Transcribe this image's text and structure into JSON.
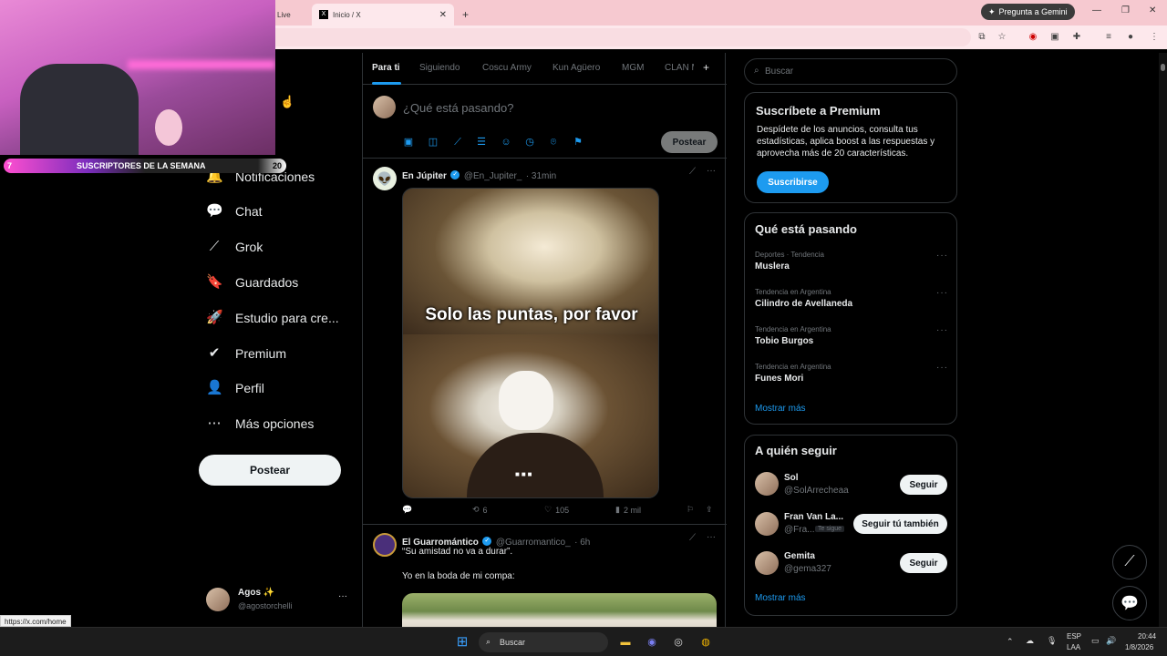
{
  "browser": {
    "tabs": [
      {
        "label": "Live"
      },
      {
        "label": "Inicio / X",
        "active": true
      }
    ],
    "new_tab": "+",
    "gemini_label": "Pregunta a Gemini",
    "status_url": "https://x.com/home"
  },
  "stream": {
    "subs_count_left": "7",
    "subs_label": "SUSCRIPTORES DE LA SEMANA",
    "subs_count_right": "20"
  },
  "nav": {
    "partial_item": "r",
    "items": [
      {
        "label": "Notificaciones",
        "icon": "bell-icon",
        "glyph": "🔔"
      },
      {
        "label": "Chat",
        "icon": "chat-icon",
        "glyph": "💬"
      },
      {
        "label": "Grok",
        "icon": "grok-icon",
        "glyph": "⟋"
      },
      {
        "label": "Guardados",
        "icon": "bookmark-icon",
        "glyph": "🔖"
      },
      {
        "label": "Estudio para cre...",
        "icon": "rocket-icon",
        "glyph": "🚀"
      },
      {
        "label": "Premium",
        "icon": "verified-icon",
        "glyph": "✔"
      },
      {
        "label": "Perfil",
        "icon": "person-icon",
        "glyph": "👤"
      },
      {
        "label": "Más opciones",
        "icon": "more-circle-icon",
        "glyph": "⋯"
      }
    ],
    "post_button": "Postear",
    "account_name": "Agos ✨",
    "account_handle": "@agostorchelli",
    "account_more": "···"
  },
  "timeline": {
    "tabs": [
      "Para ti",
      "Siguiendo",
      "Coscu Army",
      "Kun Agüero",
      "MGM",
      "CLAN M"
    ],
    "add_tab": "+",
    "compose_placeholder": "¿Qué está pasando?",
    "compose_post": "Postear",
    "tweets": [
      {
        "name": "En Júpiter",
        "handle": "@En_Jupiter_",
        "time": "· 31min",
        "image_caption": "Solo las puntas, por favor",
        "reply": "",
        "retweets": "6",
        "likes": "105",
        "views": "2 mil"
      },
      {
        "name": "El Guarromántico",
        "handle": "@Guarromantico_",
        "time": "· 6h",
        "text_1": "“Su amistad no va a durar”.",
        "text_2": "Yo en la boda de mi compa:"
      }
    ]
  },
  "sidebar": {
    "search_placeholder": "Buscar",
    "premium": {
      "title": "Suscríbete a Premium",
      "body": "Despídete de los anuncios, consulta tus estadísticas, aplica boost a las respuestas y aprovecha más de 20 características.",
      "button": "Suscribirse"
    },
    "trends": {
      "title": "Qué está pasando",
      "items": [
        {
          "category": "Deportes · Tendencia",
          "name": "Muslera"
        },
        {
          "category": "Tendencia en Argentina",
          "name": "Cilindro de Avellaneda"
        },
        {
          "category": "Tendencia en Argentina",
          "name": "Tobio Burgos"
        },
        {
          "category": "Tendencia en Argentina",
          "name": "Funes Mori"
        }
      ],
      "more": "Mostrar más"
    },
    "follow": {
      "title": "A quién seguir",
      "items": [
        {
          "name": "Sol",
          "handle": "@SolArrecheaa",
          "button": "Seguir"
        },
        {
          "name": "Fran Van La...",
          "handle": "@Fra...",
          "badge": "Te sigue",
          "button": "Seguir tú también"
        },
        {
          "name": "Gemita",
          "handle": "@gema327",
          "button": "Seguir"
        }
      ],
      "more": "Mostrar más"
    }
  },
  "taskbar": {
    "search": "Buscar",
    "lang_1": "ESP",
    "lang_2": "LAA",
    "time": "20:44",
    "date": "1/8/2026"
  },
  "colors": {
    "accent": "#1d9bf0",
    "background": "#000000",
    "border": "#2f3336",
    "tab_bar": "#f6c9d0"
  }
}
